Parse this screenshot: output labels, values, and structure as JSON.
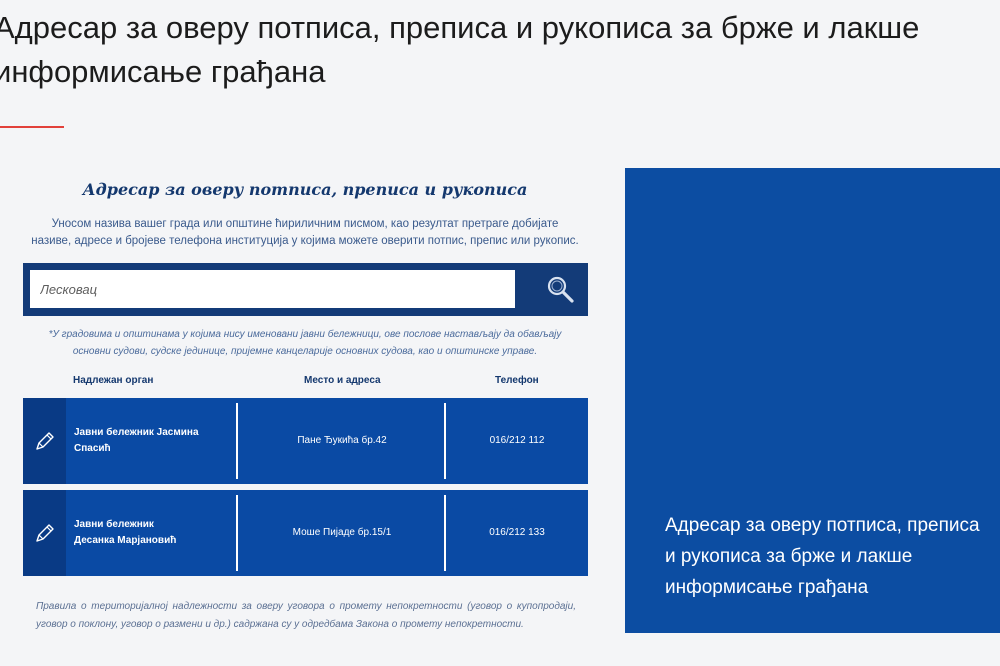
{
  "page": {
    "title_line1": "Адресар за оверу потписа, преписа и рукописа за брже и лакше",
    "title_line2": "информисање грађана"
  },
  "card": {
    "title": "Адресар за оверу потписа, преписа и рукописа",
    "intro_line1": "Уносом назива вашег града или општине ћириличним писмом, као резултат претраге добијате",
    "intro_line2": "називе, адресе и бројеве телефона институција у којима можете оверити потпис, препис или рукопис.",
    "search": {
      "placeholder": "Лесковац",
      "icon": "search-icon"
    },
    "note_line1": "*У градовима и општинама у којима нису именовани јавни бележници, ове послове настављају да обављају",
    "note_line2": "основни судови, судске јединице, пријемне канцеларије основних судова, као и општинске управе.",
    "columns": [
      "Надлежан орган",
      "Место и адреса",
      "Телефон"
    ],
    "rows": [
      {
        "authority": "Јавни бележник Јасмина Спасић",
        "address": "Пане Ђукића бр.42",
        "phone": "016/212 112",
        "icon": "pen-icon"
      },
      {
        "authority_line1": "Јавни бележник",
        "authority_line2": "Десанка Марјановић",
        "address": "Моше Пијаде бр.15/1",
        "phone": "016/212 133",
        "icon": "pen-icon"
      }
    ],
    "footnote": "Правила о територијалној надлежности за оверу уговора о промету непокретности (уговор о купопродаји, уговор о поклону, уговор о размени и др.) садржана су у одредбама Закона о промету непокретности."
  },
  "promo": {
    "text_line1": "Адресар за оверу потписа, преписа",
    "text_line2": "и рукописа за брже и лакше",
    "text_line3": "информисање грађана"
  },
  "colors": {
    "accent_red": "#e2413a",
    "navy": "#133b78",
    "blue": "#0a4aa4",
    "promo_blue": "#0c4da2"
  }
}
